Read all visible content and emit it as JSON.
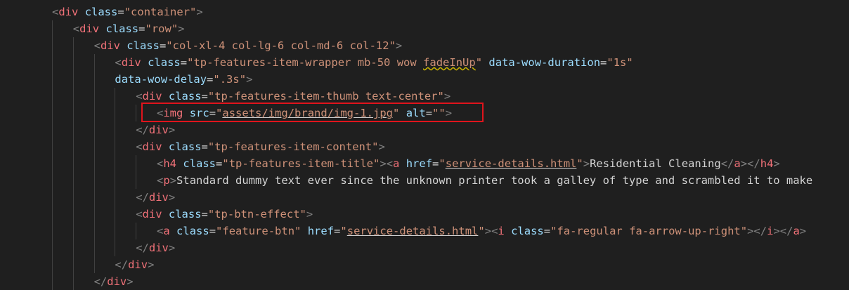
{
  "colors": {
    "background": "#1f1f1f",
    "tag": "#f07178",
    "attribute": "#9cdcfe",
    "string": "#ce9178",
    "punctuation": "#808080",
    "text": "#d4d4d4",
    "highlight_box": "#e0141c"
  },
  "lines": [
    {
      "indent": 0,
      "tokens": [
        [
          "punc",
          "<"
        ],
        [
          "tag",
          "div"
        ],
        [
          "text",
          " "
        ],
        [
          "attr",
          "class"
        ],
        [
          "eq",
          "="
        ],
        [
          "str",
          "\"container\""
        ],
        [
          "punc",
          ">"
        ]
      ]
    },
    {
      "indent": 1,
      "tokens": [
        [
          "punc",
          "<"
        ],
        [
          "tag",
          "div"
        ],
        [
          "text",
          " "
        ],
        [
          "attr",
          "class"
        ],
        [
          "eq",
          "="
        ],
        [
          "str",
          "\"row\""
        ],
        [
          "punc",
          ">"
        ]
      ]
    },
    {
      "indent": 2,
      "tokens": [
        [
          "punc",
          "<"
        ],
        [
          "tag",
          "div"
        ],
        [
          "text",
          " "
        ],
        [
          "attr",
          "class"
        ],
        [
          "eq",
          "="
        ],
        [
          "str",
          "\"col-xl-4 col-lg-6 col-md-6 col-12\""
        ],
        [
          "punc",
          ">"
        ]
      ]
    },
    {
      "indent": 3,
      "tokens": [
        [
          "punc",
          "<"
        ],
        [
          "tag",
          "div"
        ],
        [
          "text",
          " "
        ],
        [
          "attr",
          "class"
        ],
        [
          "eq",
          "="
        ],
        [
          "str",
          "\"tp-features-item-wrapper mb-50 wow "
        ],
        [
          "strwavy",
          "fadeInUp"
        ],
        [
          "str",
          "\""
        ],
        [
          "text",
          " "
        ],
        [
          "attr",
          "data-wow-duration"
        ],
        [
          "eq",
          "="
        ],
        [
          "str",
          "\"1s\""
        ]
      ]
    },
    {
      "indent": 3,
      "tokens": [
        [
          "attr",
          "data-wow-delay"
        ],
        [
          "eq",
          "="
        ],
        [
          "str",
          "\".3s\""
        ],
        [
          "punc",
          ">"
        ]
      ]
    },
    {
      "indent": 4,
      "tokens": [
        [
          "punc",
          "<"
        ],
        [
          "tag",
          "div"
        ],
        [
          "text",
          " "
        ],
        [
          "attr",
          "class"
        ],
        [
          "eq",
          "="
        ],
        [
          "str",
          "\"tp-features-item-thumb text-center\""
        ],
        [
          "punc",
          ">"
        ]
      ]
    },
    {
      "indent": 5,
      "tokens": [
        [
          "punc",
          "<"
        ],
        [
          "tag",
          "img"
        ],
        [
          "text",
          " "
        ],
        [
          "attr",
          "src"
        ],
        [
          "eq",
          "="
        ],
        [
          "str",
          "\""
        ],
        [
          "strul",
          "assets/img/brand/img-1.jpg"
        ],
        [
          "str",
          "\""
        ],
        [
          "text",
          " "
        ],
        [
          "attr",
          "alt"
        ],
        [
          "eq",
          "="
        ],
        [
          "str",
          "\"\""
        ],
        [
          "punc",
          ">"
        ]
      ]
    },
    {
      "indent": 4,
      "tokens": [
        [
          "punc",
          "</"
        ],
        [
          "tag",
          "div"
        ],
        [
          "punc",
          ">"
        ]
      ]
    },
    {
      "indent": 4,
      "tokens": [
        [
          "punc",
          "<"
        ],
        [
          "tag",
          "div"
        ],
        [
          "text",
          " "
        ],
        [
          "attr",
          "class"
        ],
        [
          "eq",
          "="
        ],
        [
          "str",
          "\"tp-features-item-content\""
        ],
        [
          "punc",
          ">"
        ]
      ]
    },
    {
      "indent": 5,
      "tokens": [
        [
          "punc",
          "<"
        ],
        [
          "tag",
          "h4"
        ],
        [
          "text",
          " "
        ],
        [
          "attr",
          "class"
        ],
        [
          "eq",
          "="
        ],
        [
          "str",
          "\"tp-features-item-title\""
        ],
        [
          "punc",
          ">"
        ],
        [
          "punc",
          "<"
        ],
        [
          "tag",
          "a"
        ],
        [
          "text",
          " "
        ],
        [
          "attr",
          "href"
        ],
        [
          "eq",
          "="
        ],
        [
          "str",
          "\""
        ],
        [
          "strul",
          "service-details.html"
        ],
        [
          "str",
          "\""
        ],
        [
          "punc",
          ">"
        ],
        [
          "text",
          "Residential Cleaning"
        ],
        [
          "punc",
          "</"
        ],
        [
          "tag",
          "a"
        ],
        [
          "punc",
          ">"
        ],
        [
          "punc",
          "</"
        ],
        [
          "tag",
          "h4"
        ],
        [
          "punc",
          ">"
        ]
      ]
    },
    {
      "indent": 5,
      "tokens": [
        [
          "punc",
          "<"
        ],
        [
          "tag",
          "p"
        ],
        [
          "punc",
          ">"
        ],
        [
          "text",
          "Standard dummy text ever since the unknown printer took a galley of type and scrambled it to make"
        ]
      ]
    },
    {
      "indent": 4,
      "tokens": [
        [
          "punc",
          "</"
        ],
        [
          "tag",
          "div"
        ],
        [
          "punc",
          ">"
        ]
      ]
    },
    {
      "indent": 4,
      "tokens": [
        [
          "punc",
          "<"
        ],
        [
          "tag",
          "div"
        ],
        [
          "text",
          " "
        ],
        [
          "attr",
          "class"
        ],
        [
          "eq",
          "="
        ],
        [
          "str",
          "\"tp-btn-effect\""
        ],
        [
          "punc",
          ">"
        ]
      ]
    },
    {
      "indent": 5,
      "tokens": [
        [
          "punc",
          "<"
        ],
        [
          "tag",
          "a"
        ],
        [
          "text",
          " "
        ],
        [
          "attr",
          "class"
        ],
        [
          "eq",
          "="
        ],
        [
          "str",
          "\"feature-btn\""
        ],
        [
          "text",
          " "
        ],
        [
          "attr",
          "href"
        ],
        [
          "eq",
          "="
        ],
        [
          "str",
          "\""
        ],
        [
          "strul",
          "service-details.html"
        ],
        [
          "str",
          "\""
        ],
        [
          "punc",
          ">"
        ],
        [
          "punc",
          "<"
        ],
        [
          "tag",
          "i"
        ],
        [
          "text",
          " "
        ],
        [
          "attr",
          "class"
        ],
        [
          "eq",
          "="
        ],
        [
          "str",
          "\"fa-regular fa-arrow-up-right\""
        ],
        [
          "punc",
          ">"
        ],
        [
          "punc",
          "</"
        ],
        [
          "tag",
          "i"
        ],
        [
          "punc",
          ">"
        ],
        [
          "punc",
          "</"
        ],
        [
          "tag",
          "a"
        ],
        [
          "punc",
          ">"
        ]
      ]
    },
    {
      "indent": 4,
      "tokens": [
        [
          "punc",
          "</"
        ],
        [
          "tag",
          "div"
        ],
        [
          "punc",
          ">"
        ]
      ]
    },
    {
      "indent": 3,
      "tokens": [
        [
          "punc",
          "</"
        ],
        [
          "tag",
          "div"
        ],
        [
          "punc",
          ">"
        ]
      ]
    },
    {
      "indent": 2,
      "tokens": [
        [
          "punc",
          "</"
        ],
        [
          "tag",
          "div"
        ],
        [
          "punc",
          ">"
        ]
      ]
    }
  ]
}
